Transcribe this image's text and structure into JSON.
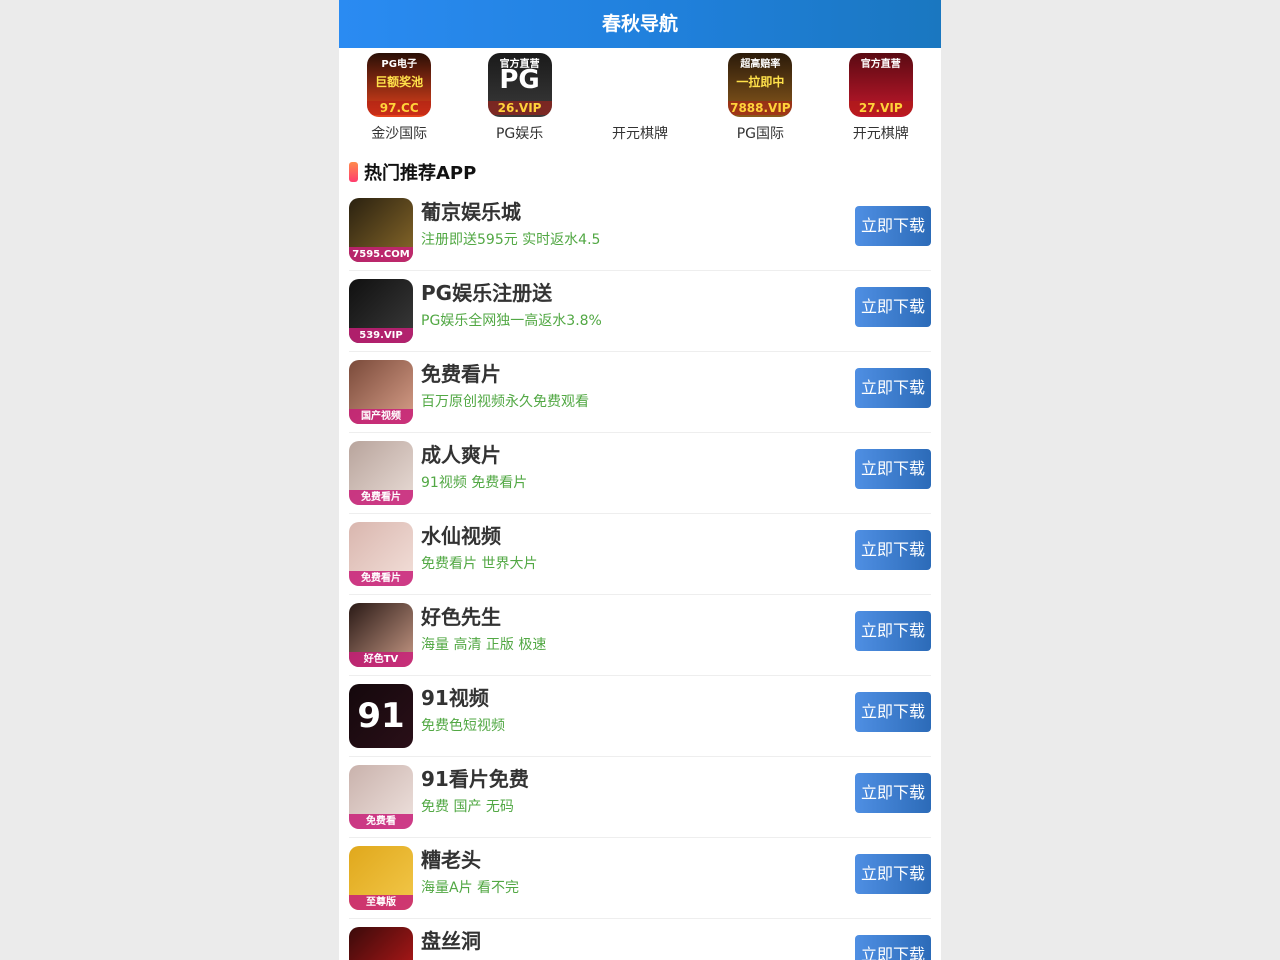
{
  "header": {
    "title": "春秋导航"
  },
  "top_nav": [
    {
      "label": "金沙国际",
      "icon": "jinsha-app-icon",
      "icon_text_top": "PG电子",
      "icon_text_mid": "巨额奖池",
      "icon_text_bottom": "97.CC",
      "icon_colors": [
        "#2a0f06",
        "#e8431c"
      ]
    },
    {
      "label": "PG娱乐",
      "icon": "pg-app-icon",
      "icon_text_top": "官方直营",
      "icon_text_mid": "PG",
      "icon_text_bottom": "26.VIP",
      "icon_colors": [
        "#1a1a1a",
        "#3a3a3a"
      ]
    },
    {
      "label": "开元棋牌",
      "icon": "kaiyuan-app-icon",
      "icon_text_top": "",
      "icon_text_mid": "",
      "icon_text_bottom": "",
      "icon_colors": [
        "#ffffff",
        "#ffffff"
      ]
    },
    {
      "label": "PG国际",
      "icon": "pg-international-app-icon",
      "icon_text_top": "超高赔率",
      "icon_text_mid": "一拉即中",
      "icon_text_bottom": "7888.VIP",
      "icon_colors": [
        "#2b1a0a",
        "#8b5a1c"
      ]
    },
    {
      "label": "开元棋牌",
      "icon": "kaiyuan-vip-app-icon",
      "icon_text_top": "官方直营",
      "icon_text_mid": "",
      "icon_text_bottom": "27.VIP",
      "icon_colors": [
        "#5a0a12",
        "#c3182c"
      ]
    }
  ],
  "section": {
    "title": "热门推荐APP"
  },
  "apps": [
    {
      "name": "葡京娱乐城",
      "desc": "注册即送595元 实时返水4.5",
      "icon_label": "7595.COM",
      "icon": "pujing-app-icon",
      "icon_colors": [
        "#2a2110",
        "#8a6a2a"
      ],
      "button": "立即下载"
    },
    {
      "name": "PG娱乐注册送",
      "desc": "PG娱乐全网独一高返水3.8%",
      "icon_label": "539.VIP",
      "icon": "pg-casino-app-icon",
      "icon_colors": [
        "#101010",
        "#3b3b3b"
      ],
      "button": "立即下载"
    },
    {
      "name": "免费看片",
      "desc": "百万原创视频永久免费观看",
      "icon_label": "国产视频",
      "icon": "free-video-app-icon",
      "icon_colors": [
        "#7a4a3a",
        "#d9a08a"
      ],
      "button": "立即下载"
    },
    {
      "name": "成人爽片",
      "desc": "91视频 免费看片",
      "icon_label": "免费看片",
      "icon": "adult-video-app-icon",
      "icon_colors": [
        "#b8a49c",
        "#e9dcd6"
      ],
      "button": "立即下载"
    },
    {
      "name": "水仙视频",
      "desc": "免费看片 世界大片",
      "icon_label": "免费看片",
      "icon": "shuixian-app-icon",
      "icon_colors": [
        "#d9b6ae",
        "#f3e0da"
      ],
      "button": "立即下载"
    },
    {
      "name": "好色先生",
      "desc": "海量 高清 正版 极速",
      "icon_label": "好色TV",
      "icon": "haose-app-icon",
      "icon_colors": [
        "#2a1a16",
        "#c89a86"
      ],
      "button": "立即下载"
    },
    {
      "name": "91视频",
      "desc": "免费色短视频",
      "icon_label": "91",
      "icon": "ninety-one-app-icon",
      "icon_colors": [
        "#14080c",
        "#2a0f18"
      ],
      "button": "立即下载"
    },
    {
      "name": "91看片免费",
      "desc": "免费 国产 无码",
      "icon_label": "免费看",
      "icon": "ninety-one-free-app-icon",
      "icon_colors": [
        "#c9b2ac",
        "#efe2de"
      ],
      "button": "立即下载"
    },
    {
      "name": "糟老头",
      "desc": "海量A片 看不完",
      "icon_label": "至尊版",
      "icon": "zaolaotou-app-icon",
      "icon_colors": [
        "#e0a81c",
        "#f3c84a"
      ],
      "button": "立即下载"
    },
    {
      "name": "盘丝洞",
      "desc": "",
      "icon_label": "",
      "icon": "pansidong-app-icon",
      "icon_colors": [
        "#3a0a0a",
        "#c21a1a"
      ],
      "button": "立即下载"
    }
  ]
}
